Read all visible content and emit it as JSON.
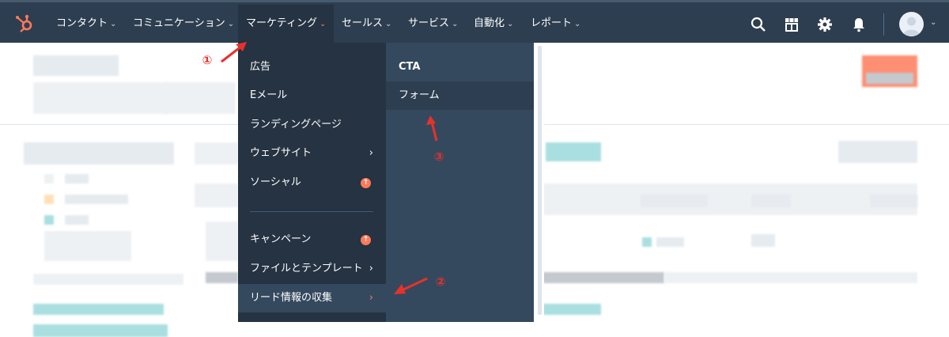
{
  "nav": {
    "items": [
      {
        "label": "コンタクト"
      },
      {
        "label": "コミュニケーション"
      },
      {
        "label": "マーケティング"
      },
      {
        "label": "セールス"
      },
      {
        "label": "サービス"
      },
      {
        "label": "自動化"
      },
      {
        "label": "レポート"
      }
    ],
    "icons": [
      "search-icon",
      "marketplace-icon",
      "gear-icon",
      "bell-icon"
    ],
    "accent": "#ff7a59",
    "background": "#2d3e50"
  },
  "menu": {
    "items": [
      {
        "label": "広告"
      },
      {
        "label": "Eメール"
      },
      {
        "label": "ランディングページ"
      },
      {
        "label": "ウェブサイト",
        "arrow": "›"
      },
      {
        "label": "ソーシャル",
        "badge": "↑"
      },
      {
        "label": "キャンペーン",
        "badge": "↑"
      },
      {
        "label": "ファイルとテンプレート",
        "arrow": "›"
      },
      {
        "label": "リード情報の収集",
        "arrow": "›"
      }
    ],
    "submenu": [
      {
        "label": "CTA"
      },
      {
        "label": "フォーム"
      }
    ]
  },
  "annotations": {
    "step1": "①",
    "step2": "②",
    "step3": "③",
    "color": "#e8312b"
  }
}
